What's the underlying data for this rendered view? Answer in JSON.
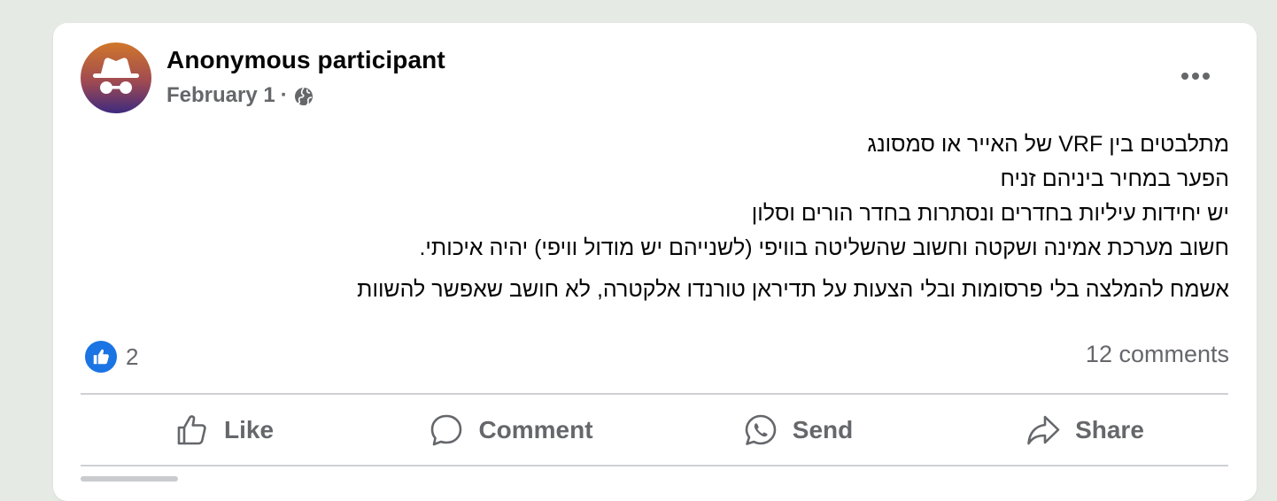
{
  "post": {
    "author": "Anonymous participant",
    "date": "February 1",
    "separator": "·",
    "audience_icon": "globe-icon",
    "more_icon": "more-options-icon",
    "body_lines": [
      "מתלבטים בין VRF של האייר או סמסונג",
      "הפער במחיר ביניהם זניח",
      "יש יחידות עיליות בחדרים ונסתרות בחדר הורים וסלון",
      "חשוב מערכת אמינה ושקטה וחשוב שהשליטה בוויפי (לשנייהם יש מודול וויפי) יהיה איכותי."
    ],
    "body_paragraph2": "אשמח להמלצה בלי פרסומות ובלי הצעות על תדיראן טורנדו אלקטרה, לא חושב שאפשר להשוות",
    "reaction_count": "2",
    "comments_count": "12 comments"
  },
  "actions": {
    "like": "Like",
    "comment": "Comment",
    "send": "Send",
    "share": "Share"
  },
  "colors": {
    "like_blue": "#1b74e4",
    "text_secondary": "#65676b",
    "background": "#e6eae4"
  }
}
